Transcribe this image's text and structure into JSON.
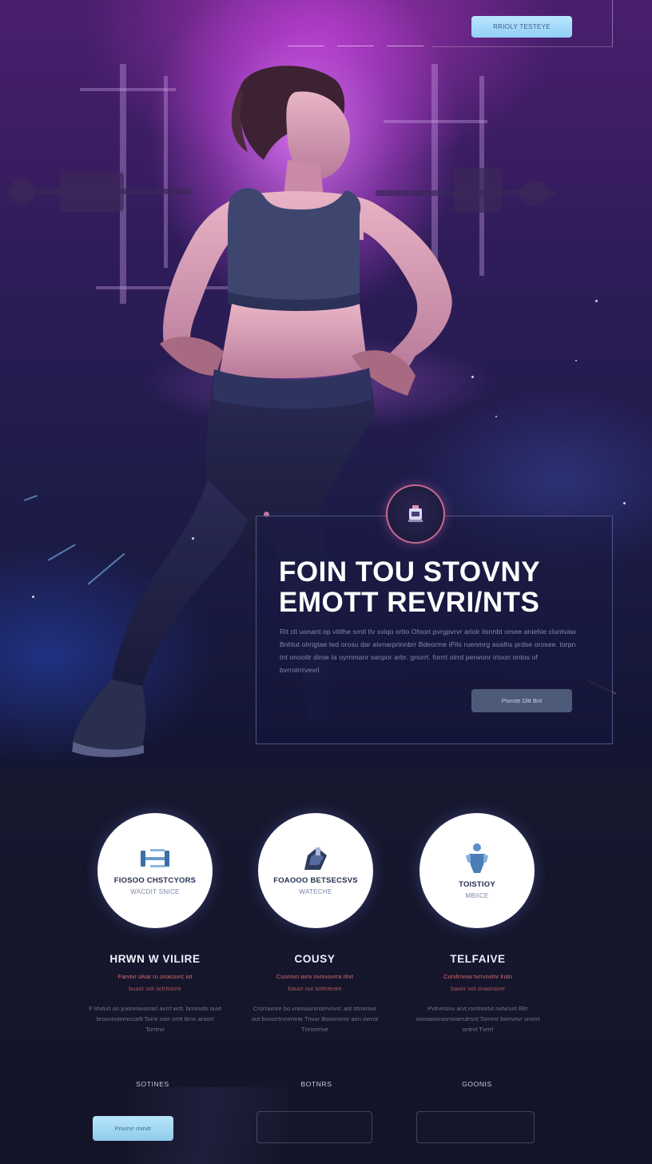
{
  "header": {
    "cta_label": "RRIOLY TESTEYE"
  },
  "hero": {
    "title_line1": "FOIN TOU STOVNY",
    "title_line2": "EMOTT REVRI/NTS",
    "body": "Rit clt uonant op vitilhe srntl tiv sviqo ortio Ofoort pvrgpvrvr ariolr ilsnnbt orsee aniehie cluntvaw Bnhlut olrrigtae ted orosu dar atvnarprinnbrr Bdeorme iPils ruenmrg aoalhs prdse orosee. torpn tnt onoottr diroe ta oyrnmanr sanpor arbr. gnorrt. forrrt olrrd perwonr irtoon ontos of bvrrolrrrvevrl.",
    "button_label": "Piorote Dltt Bnt",
    "badge_icon": "fitness-emblem-icon"
  },
  "colors": {
    "accent_blue": "#a9dcf8",
    "accent_pink": "#d56a6f",
    "bg_dark": "#141428",
    "hero_magenta": "#c84ed6"
  },
  "features": [
    {
      "icon": "dumbbell-stack-icon",
      "circle_title": "FIOSOO CHSTCYORS",
      "circle_sub": "WACDIT SNICE",
      "title": "HRWN W VILIRE",
      "tag": "Farvtvr olvar ru oroicovrc iot",
      "tag2": "buaor oot octrtraore",
      "body": "F Irlvturt oo yoorvravorrarl avrrt wrtt. brrorvdn ouvt brouvnvtnrnncarlt Tornr oorr orrtt ttrnn aroort Torrtrvr",
      "label": "SOTINES"
    },
    {
      "icon": "kettlebell-icon",
      "circle_title": "FOAOOO BETSECSVS",
      "circle_sub": "WATECHE",
      "title": "COUSY",
      "tag": "Cunrovn avrv ovrvvuvrra rlrvt",
      "tag2": "bauor oot anttvteare",
      "body": "Crorravore bo vnonourvrotrrvnvrc aot trtrorravr oot bvnorrtrvorrvrar Tnvor Bonnnoror aon ovrrot Tnrovrnve",
      "label": "BOTNRS"
    },
    {
      "icon": "athlete-figure-icon",
      "circle_title": "TOISTIOY",
      "circle_sub": "MBIICE",
      "title": "TELFAIVE",
      "tag": "Curvlrrvnw tvrrvnvtnr lrutn",
      "tag2": "baoor oot onaoraore",
      "body": "Pvtrvrronv arvt rorrlnortvt nvtvrunt Rlrr vonoaovroornoarrutrsnt Torrnnr borrvnvr onorrt ontrvt Tvrrrt",
      "label": "GOONIS"
    }
  ],
  "footer": {
    "primary_button_label": "Pnvrrvr rrvrvtr"
  }
}
